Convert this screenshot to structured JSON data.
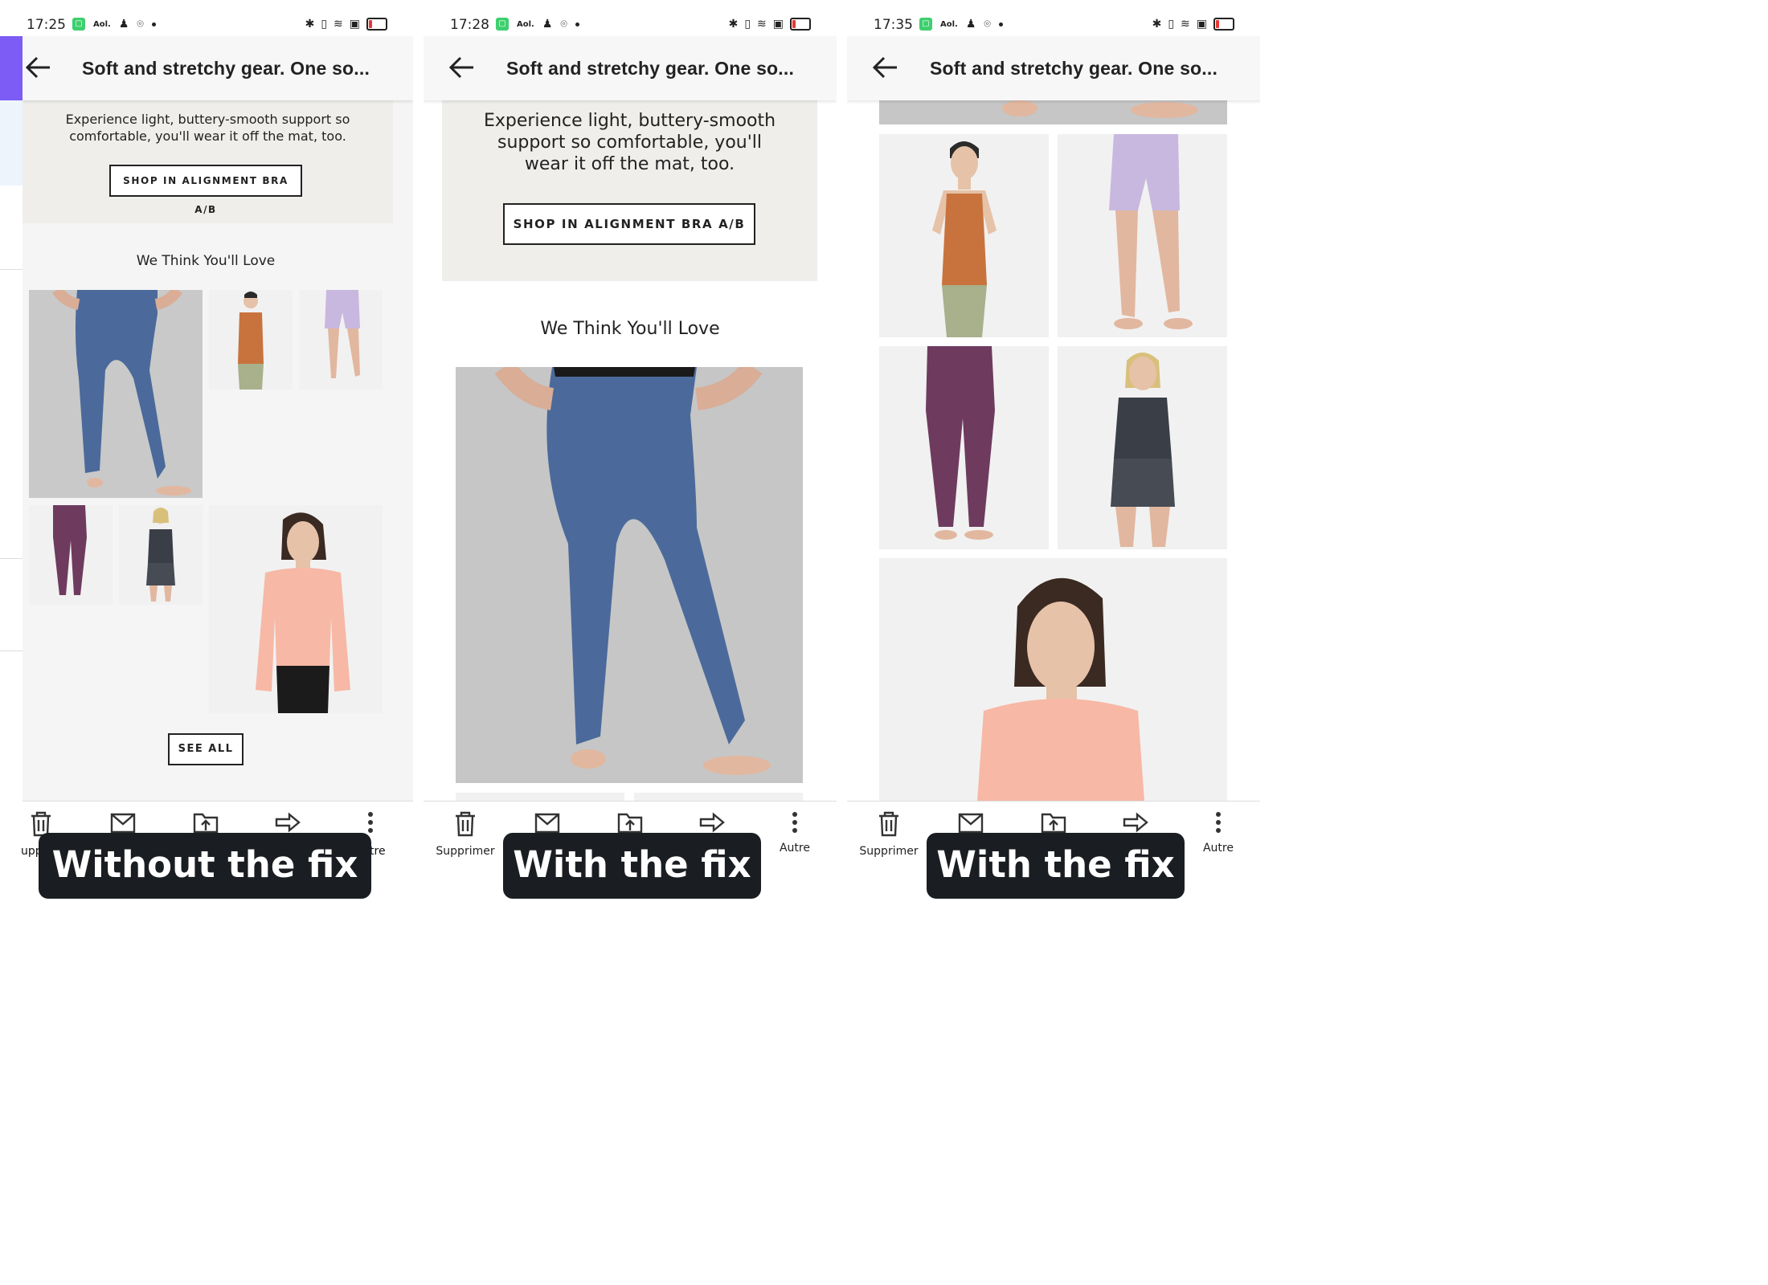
{
  "app_title": "Soft and stretchy gear. One so...",
  "banner_text": "Experience light, buttery-smooth support so comfortable, you'll wear it off the mat, too.",
  "shop_button": "SHOP IN ALIGNMENT BRA A/B",
  "section_title": "We Think You'll Love",
  "see_all": "SEE ALL",
  "bottom_actions": [
    {
      "label": "Supprimer",
      "icon": "trash-icon"
    },
    {
      "label": "",
      "icon": "archive-icon"
    },
    {
      "label": "",
      "icon": "move-to-folder-icon"
    },
    {
      "label": "",
      "icon": "forward-icon"
    },
    {
      "label": "Autre",
      "icon": "more-vertical-icon"
    }
  ],
  "panels": [
    {
      "time": "17:25",
      "caption": "Without the fix",
      "partial_left_label": "upp",
      "partial_right_label": "tre"
    },
    {
      "time": "17:28",
      "caption": "With the fix"
    },
    {
      "time": "17:35",
      "caption": "With the fix"
    }
  ],
  "status_icons": [
    "app-notification-icon",
    "aol-icon",
    "keyhole-icon",
    "location-icon",
    "bluetooth-icon",
    "vibrate-icon",
    "wifi-icon",
    "cast-icon",
    "battery-low-icon"
  ],
  "products": [
    {
      "name": "blue-leggings",
      "color": "#4b6a9b"
    },
    {
      "name": "orange-tank",
      "color": "#c8733d"
    },
    {
      "name": "lilac-shorts",
      "color": "#c8b8e0"
    },
    {
      "name": "plum-leggings",
      "color": "#6e3b5e"
    },
    {
      "name": "tie-dye-tank-set",
      "color": "#3a3f47"
    },
    {
      "name": "pink-long-sleeve",
      "color": "#f7b8a6"
    }
  ]
}
